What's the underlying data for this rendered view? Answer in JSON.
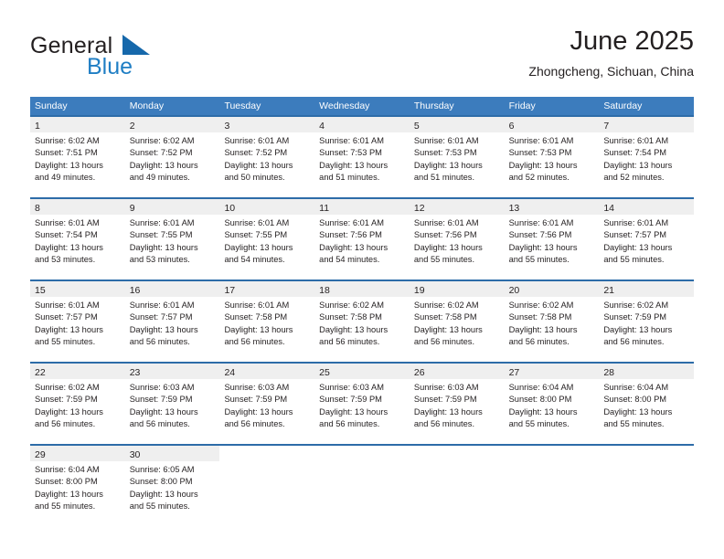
{
  "brand": {
    "name_part1": "General",
    "name_part2": "Blue",
    "triangle_color": "#1668ab",
    "blue_color": "#1f7ec4"
  },
  "header": {
    "title": "June 2025",
    "location": "Zhongcheng, Sichuan, China"
  },
  "calendar": {
    "header_bg": "#3c7cbd",
    "row_border": "#2d6ca8",
    "date_band_bg": "#efefef",
    "weekdays": [
      "Sunday",
      "Monday",
      "Tuesday",
      "Wednesday",
      "Thursday",
      "Friday",
      "Saturday"
    ],
    "weeks": [
      [
        {
          "date": "1",
          "lines": [
            "Sunrise: 6:02 AM",
            "Sunset: 7:51 PM",
            "Daylight: 13 hours",
            "and 49 minutes."
          ]
        },
        {
          "date": "2",
          "lines": [
            "Sunrise: 6:02 AM",
            "Sunset: 7:52 PM",
            "Daylight: 13 hours",
            "and 49 minutes."
          ]
        },
        {
          "date": "3",
          "lines": [
            "Sunrise: 6:01 AM",
            "Sunset: 7:52 PM",
            "Daylight: 13 hours",
            "and 50 minutes."
          ]
        },
        {
          "date": "4",
          "lines": [
            "Sunrise: 6:01 AM",
            "Sunset: 7:53 PM",
            "Daylight: 13 hours",
            "and 51 minutes."
          ]
        },
        {
          "date": "5",
          "lines": [
            "Sunrise: 6:01 AM",
            "Sunset: 7:53 PM",
            "Daylight: 13 hours",
            "and 51 minutes."
          ]
        },
        {
          "date": "6",
          "lines": [
            "Sunrise: 6:01 AM",
            "Sunset: 7:53 PM",
            "Daylight: 13 hours",
            "and 52 minutes."
          ]
        },
        {
          "date": "7",
          "lines": [
            "Sunrise: 6:01 AM",
            "Sunset: 7:54 PM",
            "Daylight: 13 hours",
            "and 52 minutes."
          ]
        }
      ],
      [
        {
          "date": "8",
          "lines": [
            "Sunrise: 6:01 AM",
            "Sunset: 7:54 PM",
            "Daylight: 13 hours",
            "and 53 minutes."
          ]
        },
        {
          "date": "9",
          "lines": [
            "Sunrise: 6:01 AM",
            "Sunset: 7:55 PM",
            "Daylight: 13 hours",
            "and 53 minutes."
          ]
        },
        {
          "date": "10",
          "lines": [
            "Sunrise: 6:01 AM",
            "Sunset: 7:55 PM",
            "Daylight: 13 hours",
            "and 54 minutes."
          ]
        },
        {
          "date": "11",
          "lines": [
            "Sunrise: 6:01 AM",
            "Sunset: 7:56 PM",
            "Daylight: 13 hours",
            "and 54 minutes."
          ]
        },
        {
          "date": "12",
          "lines": [
            "Sunrise: 6:01 AM",
            "Sunset: 7:56 PM",
            "Daylight: 13 hours",
            "and 55 minutes."
          ]
        },
        {
          "date": "13",
          "lines": [
            "Sunrise: 6:01 AM",
            "Sunset: 7:56 PM",
            "Daylight: 13 hours",
            "and 55 minutes."
          ]
        },
        {
          "date": "14",
          "lines": [
            "Sunrise: 6:01 AM",
            "Sunset: 7:57 PM",
            "Daylight: 13 hours",
            "and 55 minutes."
          ]
        }
      ],
      [
        {
          "date": "15",
          "lines": [
            "Sunrise: 6:01 AM",
            "Sunset: 7:57 PM",
            "Daylight: 13 hours",
            "and 55 minutes."
          ]
        },
        {
          "date": "16",
          "lines": [
            "Sunrise: 6:01 AM",
            "Sunset: 7:57 PM",
            "Daylight: 13 hours",
            "and 56 minutes."
          ]
        },
        {
          "date": "17",
          "lines": [
            "Sunrise: 6:01 AM",
            "Sunset: 7:58 PM",
            "Daylight: 13 hours",
            "and 56 minutes."
          ]
        },
        {
          "date": "18",
          "lines": [
            "Sunrise: 6:02 AM",
            "Sunset: 7:58 PM",
            "Daylight: 13 hours",
            "and 56 minutes."
          ]
        },
        {
          "date": "19",
          "lines": [
            "Sunrise: 6:02 AM",
            "Sunset: 7:58 PM",
            "Daylight: 13 hours",
            "and 56 minutes."
          ]
        },
        {
          "date": "20",
          "lines": [
            "Sunrise: 6:02 AM",
            "Sunset: 7:58 PM",
            "Daylight: 13 hours",
            "and 56 minutes."
          ]
        },
        {
          "date": "21",
          "lines": [
            "Sunrise: 6:02 AM",
            "Sunset: 7:59 PM",
            "Daylight: 13 hours",
            "and 56 minutes."
          ]
        }
      ],
      [
        {
          "date": "22",
          "lines": [
            "Sunrise: 6:02 AM",
            "Sunset: 7:59 PM",
            "Daylight: 13 hours",
            "and 56 minutes."
          ]
        },
        {
          "date": "23",
          "lines": [
            "Sunrise: 6:03 AM",
            "Sunset: 7:59 PM",
            "Daylight: 13 hours",
            "and 56 minutes."
          ]
        },
        {
          "date": "24",
          "lines": [
            "Sunrise: 6:03 AM",
            "Sunset: 7:59 PM",
            "Daylight: 13 hours",
            "and 56 minutes."
          ]
        },
        {
          "date": "25",
          "lines": [
            "Sunrise: 6:03 AM",
            "Sunset: 7:59 PM",
            "Daylight: 13 hours",
            "and 56 minutes."
          ]
        },
        {
          "date": "26",
          "lines": [
            "Sunrise: 6:03 AM",
            "Sunset: 7:59 PM",
            "Daylight: 13 hours",
            "and 56 minutes."
          ]
        },
        {
          "date": "27",
          "lines": [
            "Sunrise: 6:04 AM",
            "Sunset: 8:00 PM",
            "Daylight: 13 hours",
            "and 55 minutes."
          ]
        },
        {
          "date": "28",
          "lines": [
            "Sunrise: 6:04 AM",
            "Sunset: 8:00 PM",
            "Daylight: 13 hours",
            "and 55 minutes."
          ]
        }
      ],
      [
        {
          "date": "29",
          "lines": [
            "Sunrise: 6:04 AM",
            "Sunset: 8:00 PM",
            "Daylight: 13 hours",
            "and 55 minutes."
          ]
        },
        {
          "date": "30",
          "lines": [
            "Sunrise: 6:05 AM",
            "Sunset: 8:00 PM",
            "Daylight: 13 hours",
            "and 55 minutes."
          ]
        },
        {
          "date": "",
          "lines": []
        },
        {
          "date": "",
          "lines": []
        },
        {
          "date": "",
          "lines": []
        },
        {
          "date": "",
          "lines": []
        },
        {
          "date": "",
          "lines": []
        }
      ]
    ]
  }
}
